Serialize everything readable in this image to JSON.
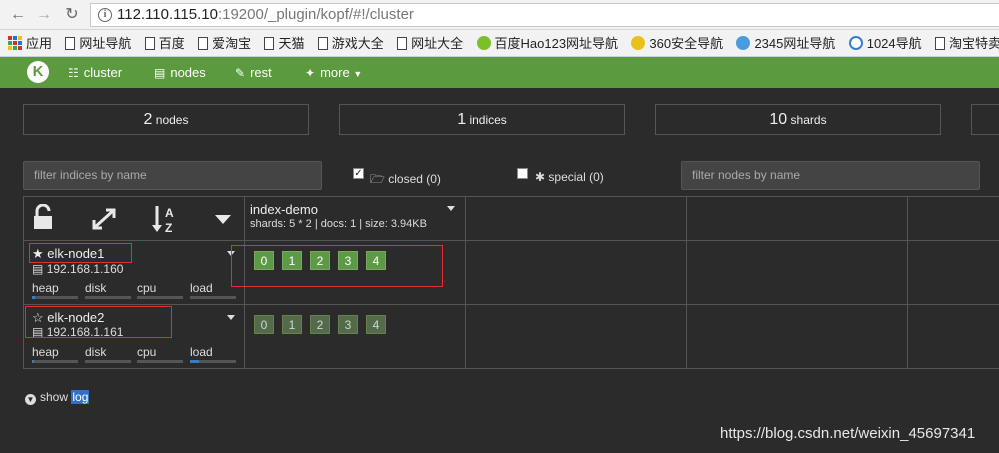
{
  "browser": {
    "url_host": "112.110.115.10",
    "url_rest": ":19200/_plugin/kopf/#!/cluster",
    "bookmarks": [
      "应用",
      "网址导航",
      "百度",
      "爱淘宝",
      "天猫",
      "游戏大全",
      "网址大全",
      "百度Hao123网址导航",
      "360安全导航",
      "2345网址导航",
      "1024导航",
      "淘宝特卖"
    ]
  },
  "navbar": {
    "logo": "K",
    "items": [
      "cluster",
      "nodes",
      "rest",
      "more"
    ]
  },
  "stats": [
    {
      "num": "2",
      "label": "nodes"
    },
    {
      "num": "1",
      "label": "indices"
    },
    {
      "num": "10",
      "label": "shards"
    }
  ],
  "filters": {
    "indices_placeholder": "filter indices by name",
    "closed_label": "closed (0)",
    "special_label": "special (0)",
    "nodes_placeholder": "filter nodes by name"
  },
  "index": {
    "name": "index-demo",
    "meta": "shards: 5 * 2 | docs: 1 | size: 3.94KB"
  },
  "nodes": [
    {
      "name": "elk-node1",
      "ip": "192.168.1.160",
      "master": true,
      "heap": 0.06,
      "disk": 0.0,
      "cpu": 0.0,
      "load": 0.0
    },
    {
      "name": "elk-node2",
      "ip": "192.168.1.161",
      "master": false,
      "heap": 0.05,
      "disk": 0.0,
      "cpu": 0.0,
      "load": 0.2
    }
  ],
  "metric_labels": [
    "heap",
    "disk",
    "cpu",
    "load"
  ],
  "shards": [
    "0",
    "1",
    "2",
    "3",
    "4"
  ],
  "showlog": {
    "prefix": "show",
    "highlight": "log"
  },
  "watermark": "https://blog.csdn.net/weixin_45697341"
}
